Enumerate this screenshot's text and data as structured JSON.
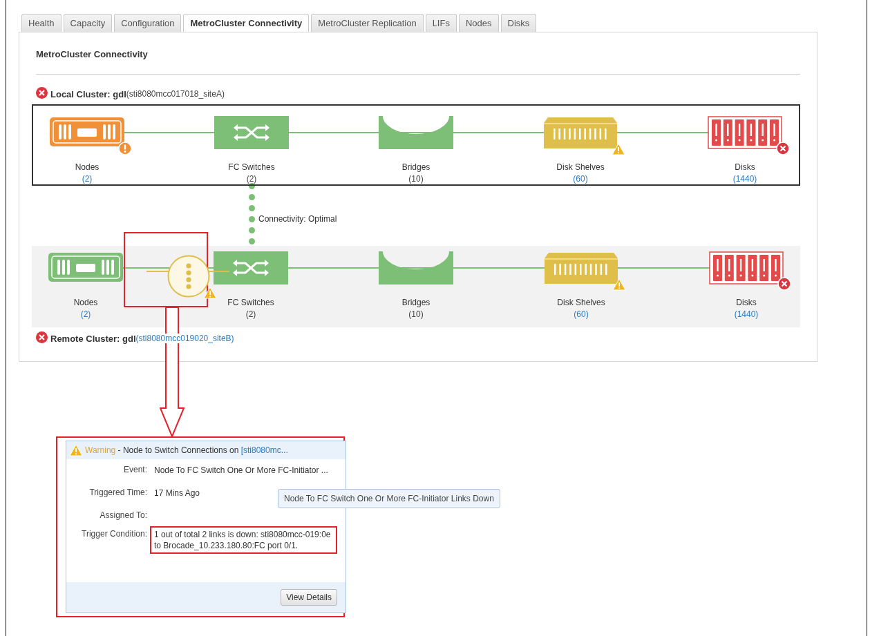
{
  "tabs": [
    {
      "label": "Health",
      "selected": false
    },
    {
      "label": "Capacity",
      "selected": false
    },
    {
      "label": "Configuration",
      "selected": false
    },
    {
      "label": "MetroCluster Connectivity",
      "selected": true
    },
    {
      "label": "MetroCluster Replication",
      "selected": false
    },
    {
      "label": "LIFs",
      "selected": false
    },
    {
      "label": "Nodes",
      "selected": false
    },
    {
      "label": "Disks",
      "selected": false
    }
  ],
  "panel_title": "MetroCluster Connectivity",
  "local_cluster": {
    "error": true,
    "label": "Local Cluster: gdl",
    "site": "(sti8080mcc017018_siteA)",
    "site_link": false,
    "components": [
      {
        "kind": "nodes",
        "name": "Nodes",
        "count": "(2)",
        "count_link": true,
        "color": "#f0913a",
        "badge": {
          "kind": "alert"
        }
      },
      {
        "kind": "switch",
        "name": "FC Switches",
        "count": "(2)",
        "count_link": false,
        "color": "#7dbf76"
      },
      {
        "kind": "bridge",
        "name": "Bridges",
        "count": "(10)",
        "count_link": false,
        "color": "#7dbf76"
      },
      {
        "kind": "shelf",
        "name": "Disk Shelves",
        "count": "(60)",
        "count_link": true,
        "color": "#e0be4a",
        "badge": {
          "kind": "warning"
        }
      },
      {
        "kind": "disks",
        "name": "Disks",
        "count": "(1440)",
        "count_link": true,
        "color": "#e24b4b",
        "badge": {
          "kind": "error"
        }
      }
    ]
  },
  "connectivity": {
    "label": "Connectivity: Optimal",
    "color": "#7dbf76"
  },
  "remote_cluster": {
    "error": true,
    "label": "Remote Cluster: gdl",
    "site": "(sti8080mcc019020_siteB)",
    "site_link": true,
    "port_link": {
      "color": "#e0be4a",
      "badge": {
        "kind": "warning"
      }
    },
    "components": [
      {
        "kind": "nodes",
        "name": "Nodes",
        "count": "(2)",
        "count_link": true,
        "color": "#7dbf76"
      },
      {
        "kind": "switch",
        "name": "FC Switches",
        "count": "(2)",
        "count_link": false,
        "color": "#7dbf76"
      },
      {
        "kind": "bridge",
        "name": "Bridges",
        "count": "(10)",
        "count_link": false,
        "color": "#7dbf76"
      },
      {
        "kind": "shelf",
        "name": "Disk Shelves",
        "count": "(60)",
        "count_link": true,
        "color": "#e0be4a",
        "badge": {
          "kind": "warning"
        }
      },
      {
        "kind": "disks",
        "name": "Disks",
        "count": "(1440)",
        "count_link": true,
        "color": "#e24b4b",
        "badge": {
          "kind": "error"
        }
      }
    ]
  },
  "popup": {
    "severity": "Warning",
    "title": " - Node to Switch Connections on ",
    "source": "[sti8080mc...",
    "fields": [
      {
        "label": "Event:",
        "value": "Node To FC Switch One Or More FC-Initiator ...",
        "highlighted": false
      },
      {
        "label": "Triggered Time:",
        "value": "17 Mins Ago",
        "highlighted": false
      },
      {
        "label": "Assigned To:",
        "highlighted": false
      },
      {
        "label": "Trigger Condition:",
        "value": "1 out of total 2 links is down: sti8080mcc-019:0e to Brocade_10.233.180.80:FC port 0/1.",
        "highlighted": true
      }
    ],
    "button": "View Details"
  },
  "tooltip": "Node To FC Switch One Or More FC-Initiator Links Down"
}
